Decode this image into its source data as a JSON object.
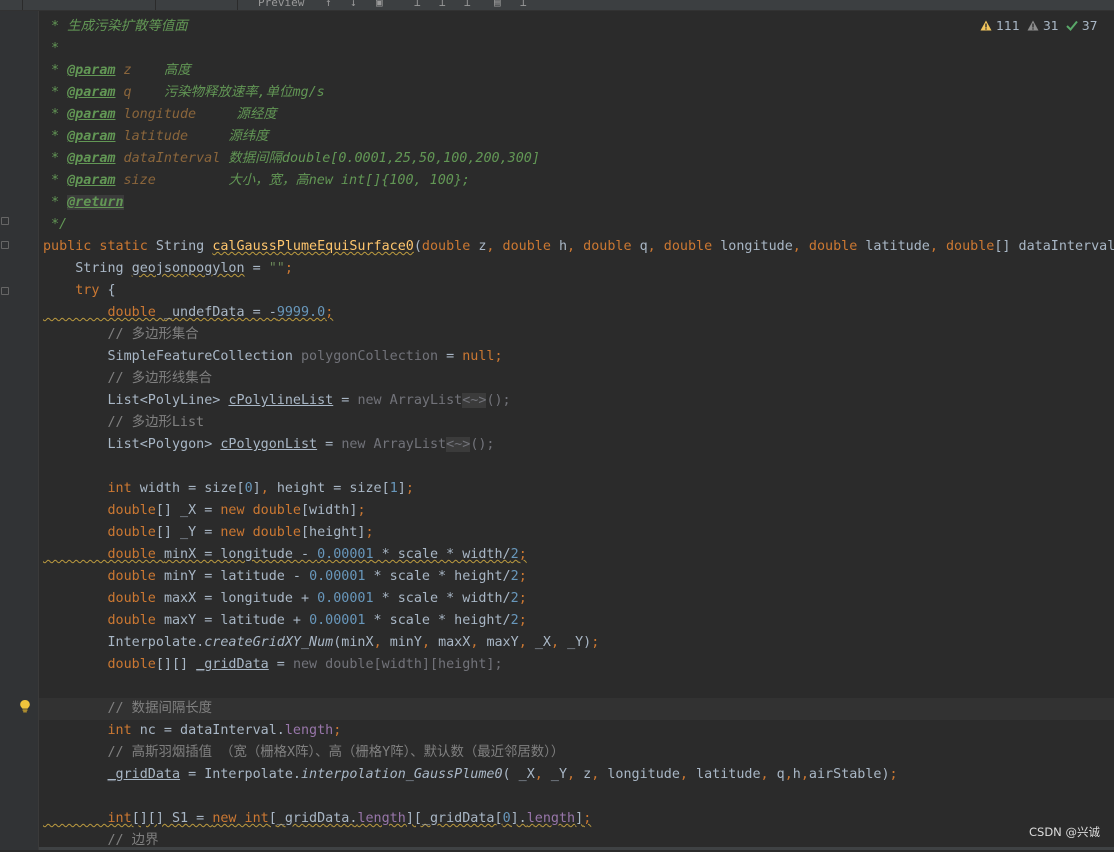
{
  "window": {
    "tab_label": "Preview"
  },
  "inspection": {
    "warnings": "111",
    "weak_warnings": "31",
    "typos": "37"
  },
  "code_lines": [
    [
      [
        "c",
        "* 生成污染扩散等值面"
      ]
    ],
    [
      [
        "c",
        "*"
      ]
    ],
    [
      [
        "c",
        "* "
      ],
      [
        "tg",
        "@param"
      ],
      [
        "pn",
        " z"
      ],
      [
        "c",
        "    高度"
      ]
    ],
    [
      [
        "c",
        "* "
      ],
      [
        "tg",
        "@param"
      ],
      [
        "pn",
        " q"
      ],
      [
        "c",
        "    污染物释放速率,单位mg/s"
      ]
    ],
    [
      [
        "c",
        "* "
      ],
      [
        "tg",
        "@param"
      ],
      [
        "pn",
        " longitude"
      ],
      [
        "c",
        "     源经度"
      ]
    ],
    [
      [
        "c",
        "* "
      ],
      [
        "tg",
        "@param"
      ],
      [
        "pn",
        " latitude"
      ],
      [
        "c",
        "     源纬度"
      ]
    ],
    [
      [
        "c",
        "* "
      ],
      [
        "tg",
        "@param"
      ],
      [
        "pn",
        " dataInterval"
      ],
      [
        "c",
        " 数据间隔double[0.0001,25,50,100,200,300]"
      ]
    ],
    [
      [
        "c",
        "* "
      ],
      [
        "tg",
        "@param"
      ],
      [
        "pn",
        " size"
      ],
      [
        "c",
        "         大小，宽，高new int[]{100, 100};"
      ]
    ],
    [
      [
        "c",
        "* "
      ],
      [
        "tg hl",
        "@return"
      ]
    ],
    [
      [
        "c",
        "*/"
      ]
    ],
    [
      [
        "kw",
        "public static "
      ],
      [
        "",
        "String "
      ],
      [
        "fn wv",
        "calGaussPlumeEquiSurface0"
      ],
      [
        "",
        "("
      ],
      [
        "kw",
        "double "
      ],
      [
        "",
        "z"
      ],
      [
        "kw",
        ", double "
      ],
      [
        "",
        "h"
      ],
      [
        "kw",
        ", double "
      ],
      [
        "",
        "q"
      ],
      [
        "kw",
        ", double "
      ],
      [
        "",
        "longitude"
      ],
      [
        "kw",
        ", double "
      ],
      [
        "",
        "latitude"
      ],
      [
        "kw",
        ", double"
      ],
      [
        "",
        "[] dataInterval"
      ],
      [
        "kw",
        ","
      ]
    ],
    [
      [
        "",
        "    String "
      ],
      [
        "wv",
        "geojsonpogylon"
      ],
      [
        "",
        " = "
      ],
      [
        "st",
        "\"\""
      ],
      [
        "kw",
        ";"
      ]
    ],
    [
      [
        "kw",
        "    try "
      ],
      [
        "",
        "{"
      ]
    ],
    [
      [
        "kw wv",
        "        double "
      ],
      [
        "wv",
        "_undefData = -"
      ],
      [
        "nm wv",
        "9999.0"
      ],
      [
        "kw wv",
        ";"
      ]
    ],
    [
      [
        "lc",
        "        // 多边形集合"
      ]
    ],
    [
      [
        "",
        "        SimpleFeatureCollection "
      ],
      [
        "gr",
        "polygonCollection"
      ],
      [
        "",
        " = "
      ],
      [
        "kw",
        "null;"
      ]
    ],
    [
      [
        "lc",
        "        // 多边形线集合"
      ]
    ],
    [
      [
        "",
        "        List<PolyLine> "
      ],
      [
        "ul",
        "cPolylineList"
      ],
      [
        "",
        " = "
      ],
      [
        "gr",
        "new ArrayList"
      ],
      [
        "gr hl",
        "<~>"
      ],
      [
        "gr",
        "();"
      ]
    ],
    [
      [
        "lc",
        "        // 多边形List"
      ]
    ],
    [
      [
        "",
        "        List<Polygon> "
      ],
      [
        "ul",
        "cPolygonList"
      ],
      [
        "",
        " = "
      ],
      [
        "gr",
        "new ArrayList"
      ],
      [
        "gr hl",
        "<~>"
      ],
      [
        "gr",
        "();"
      ]
    ],
    [
      [
        "",
        ""
      ]
    ],
    [
      [
        "kw",
        "        int "
      ],
      [
        "",
        "width = size["
      ],
      [
        "nm",
        "0"
      ],
      [
        "",
        "]"
      ],
      [
        "kw",
        ", "
      ],
      [
        "",
        "height = size["
      ],
      [
        "nm",
        "1"
      ],
      [
        "",
        "]"
      ],
      [
        "kw",
        ";"
      ]
    ],
    [
      [
        "kw",
        "        double"
      ],
      [
        "",
        "[] _X = "
      ],
      [
        "kw",
        "new double"
      ],
      [
        "",
        "[width]"
      ],
      [
        "kw",
        ";"
      ]
    ],
    [
      [
        "kw",
        "        double"
      ],
      [
        "",
        "[] _Y = "
      ],
      [
        "kw",
        "new double"
      ],
      [
        "",
        "[height]"
      ],
      [
        "kw",
        ";"
      ]
    ],
    [
      [
        "kw wv",
        "        double "
      ],
      [
        "wv",
        "minX = longitude - "
      ],
      [
        "nm wv",
        "0.00001"
      ],
      [
        "wv",
        " * scale * width/"
      ],
      [
        "nm wv",
        "2"
      ],
      [
        "kw wv",
        ";"
      ]
    ],
    [
      [
        "kw",
        "        double "
      ],
      [
        "",
        "minY = latitude - "
      ],
      [
        "nm",
        "0.00001"
      ],
      [
        "",
        " * scale * height/"
      ],
      [
        "nm",
        "2"
      ],
      [
        "kw",
        ";"
      ]
    ],
    [
      [
        "kw",
        "        double "
      ],
      [
        "",
        "maxX = longitude + "
      ],
      [
        "nm",
        "0.00001"
      ],
      [
        "",
        " * scale * width/"
      ],
      [
        "nm",
        "2"
      ],
      [
        "kw",
        ";"
      ]
    ],
    [
      [
        "kw",
        "        double "
      ],
      [
        "",
        "maxY = latitude + "
      ],
      [
        "nm",
        "0.00001"
      ],
      [
        "",
        " * scale * height/"
      ],
      [
        "nm",
        "2"
      ],
      [
        "kw",
        ";"
      ]
    ],
    [
      [
        "",
        "        Interpolate."
      ],
      [
        "it",
        "createGridXY_Num"
      ],
      [
        "",
        "(minX"
      ],
      [
        "kw",
        ", "
      ],
      [
        "",
        "minY"
      ],
      [
        "kw",
        ", "
      ],
      [
        "",
        "maxX"
      ],
      [
        "kw",
        ", "
      ],
      [
        "",
        "maxY"
      ],
      [
        "kw",
        ", "
      ],
      [
        "",
        "_X"
      ],
      [
        "kw",
        ", "
      ],
      [
        "",
        "_Y)"
      ],
      [
        "kw",
        ";"
      ]
    ],
    [
      [
        "kw",
        "        double"
      ],
      [
        "",
        "[][] "
      ],
      [
        "ul",
        "_gridData"
      ],
      [
        "",
        " = "
      ],
      [
        "gr",
        "new double[width][height];"
      ]
    ],
    [
      [
        "",
        ""
      ]
    ],
    [
      [
        "lc",
        "        // 数据间隔长度"
      ]
    ],
    [
      [
        "kw",
        "        int "
      ],
      [
        "",
        "nc = dataInterval."
      ],
      [
        "fd",
        "length"
      ],
      [
        "kw",
        ";"
      ]
    ],
    [
      [
        "lc",
        "        // 高斯羽烟插值 （宽（栅格X阵）、高（栅格Y阵）、默认数（最近邻居数））"
      ]
    ],
    [
      [
        "",
        "        "
      ],
      [
        "ul",
        "_gridData"
      ],
      [
        "",
        " = Interpolate."
      ],
      [
        "it",
        "interpolation_GaussPlume0"
      ],
      [
        "",
        "( _X"
      ],
      [
        "kw",
        ", "
      ],
      [
        "",
        "_Y"
      ],
      [
        "kw",
        ", "
      ],
      [
        "",
        "z"
      ],
      [
        "kw",
        ", "
      ],
      [
        "",
        "longitude"
      ],
      [
        "kw",
        ", "
      ],
      [
        "",
        "latitude"
      ],
      [
        "kw",
        ", "
      ],
      [
        "",
        "q"
      ],
      [
        "kw",
        ","
      ],
      [
        "",
        "h"
      ],
      [
        "kw",
        ","
      ],
      [
        "",
        "airStable)"
      ],
      [
        "kw",
        ";"
      ]
    ],
    [
      [
        "",
        ""
      ]
    ],
    [
      [
        "kw wv",
        "        int"
      ],
      [
        "wv",
        "[][] S1 = "
      ],
      [
        "kw wv",
        "new int"
      ],
      [
        "wv",
        "[_gridData."
      ],
      [
        "fd wv",
        "length"
      ],
      [
        "wv",
        "][_gridData["
      ],
      [
        "nm wv",
        "0"
      ],
      [
        "wv",
        "]."
      ],
      [
        "fd wv",
        "length"
      ],
      [
        "wv",
        "]"
      ],
      [
        "kw wv",
        ";"
      ]
    ],
    [
      [
        "lc",
        "        // 边界"
      ]
    ]
  ],
  "watermark": "CSDN @兴诚"
}
